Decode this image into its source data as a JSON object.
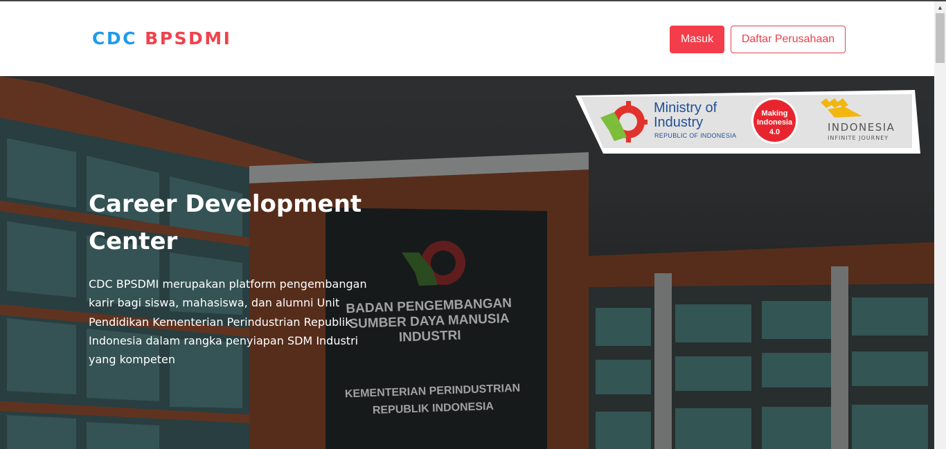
{
  "brand": {
    "part1": "CDC",
    "part2": "BPSDMI"
  },
  "nav": {
    "login_label": "Masuk",
    "register_label": "Daftar Perusahaan"
  },
  "hero": {
    "title": "Career Development Center",
    "description": "CDC BPSDMI merupakan platform pengembangan karir bagi siswa, mahasiswa, dan alumni Unit Pendidikan Kementerian Perindustrian Republik Indonesia dalam rangka penyiapan SDM Industri yang kompeten"
  },
  "banner": {
    "ministry_line1": "Ministry of",
    "ministry_line2": "Industry",
    "ministry_sub": "REPUBLIC OF INDONESIA",
    "making_line1": "Making",
    "making_line2": "Indonesia",
    "making_line3": "4.0",
    "indonesia_word": "INDONESIA",
    "indonesia_sub": "INFINITE JOURNEY"
  },
  "building_sign": {
    "line1": "BADAN PENGEMBANGAN",
    "line2": "SUMBER DAYA MANUSIA",
    "line3": "INDUSTRI",
    "line4": "KEMENTERIAN PERINDUSTRIAN",
    "line5": "REPUBLIK INDONESIA"
  },
  "colors": {
    "brand_blue": "#1e9be9",
    "brand_red": "#f0424c",
    "button_red": "#f33d4a"
  },
  "icons": [
    "ministry-gear-logo",
    "making-indonesia-badge",
    "wonderful-indonesia-logo",
    "scroll-up-arrow-icon"
  ]
}
